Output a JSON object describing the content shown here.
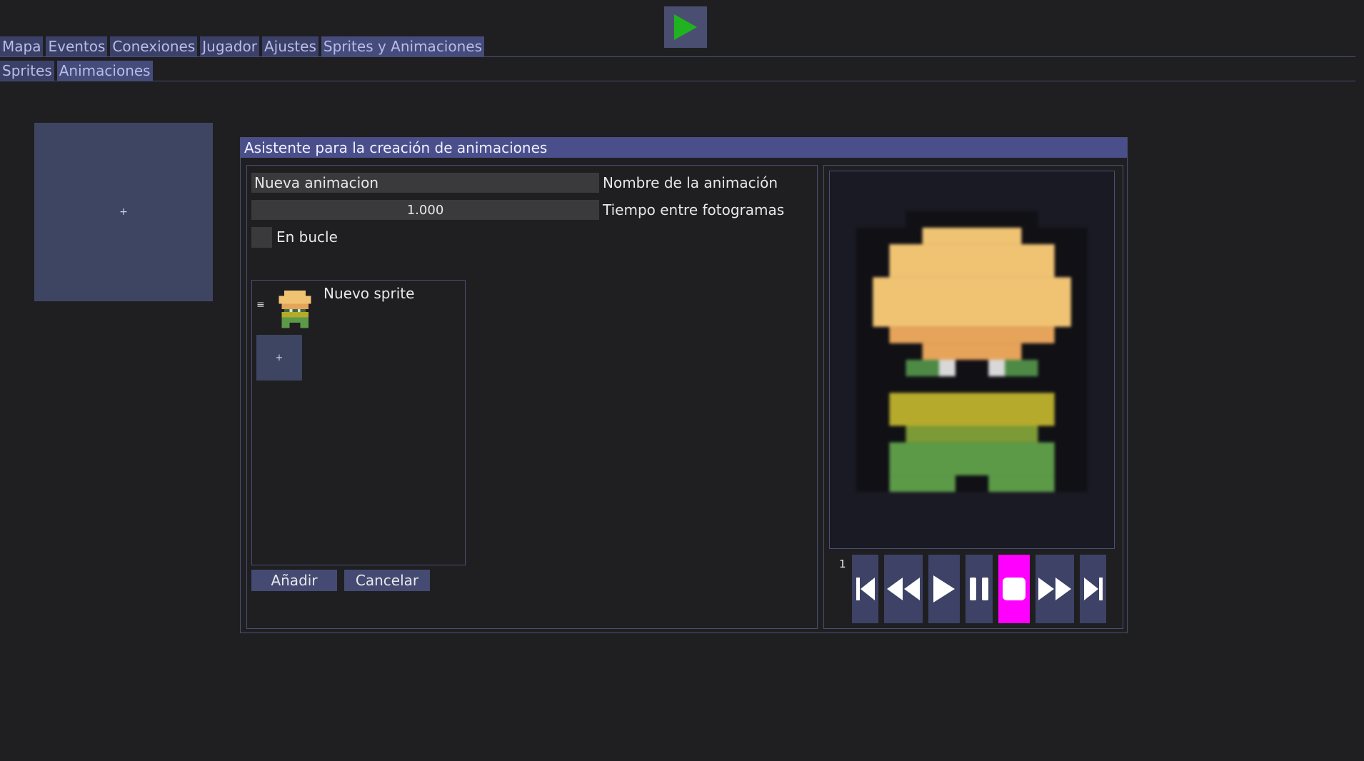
{
  "toolbar": {
    "play_icon": "play-icon",
    "accent_play": "#22aa22"
  },
  "main_tabs": [
    "Mapa",
    "Eventos",
    "Conexiones",
    "Jugador",
    "Ajustes",
    "Sprites y Animaciones"
  ],
  "sub_tabs": [
    "Sprites",
    "Animaciones"
  ],
  "add_tile": {
    "symbol": "+"
  },
  "wizard": {
    "title": "Asistente para la creación de animaciones",
    "name_value": "Nueva animacion",
    "name_label": "Nombre de la animación",
    "time_value": "1.000",
    "time_label": "Tiempo entre fotogramas",
    "loop_label": "En bucle",
    "loop_checked": false,
    "frames": [
      {
        "label": "Nuevo sprite",
        "handle": "≡"
      }
    ],
    "add_frame_symbol": "+",
    "add_button": "Añadir",
    "cancel_button": "Cancelar",
    "frame_index": "1",
    "controls": [
      "first-frame-icon",
      "rewind-icon",
      "play-icon",
      "pause-icon",
      "stop-icon",
      "fast-forward-icon",
      "last-frame-icon"
    ],
    "active_control": "stop-icon",
    "colors": {
      "title_bar": "#4a4f8c",
      "active_control": "#ff00ff",
      "panel_border": "#4a4f72"
    }
  }
}
